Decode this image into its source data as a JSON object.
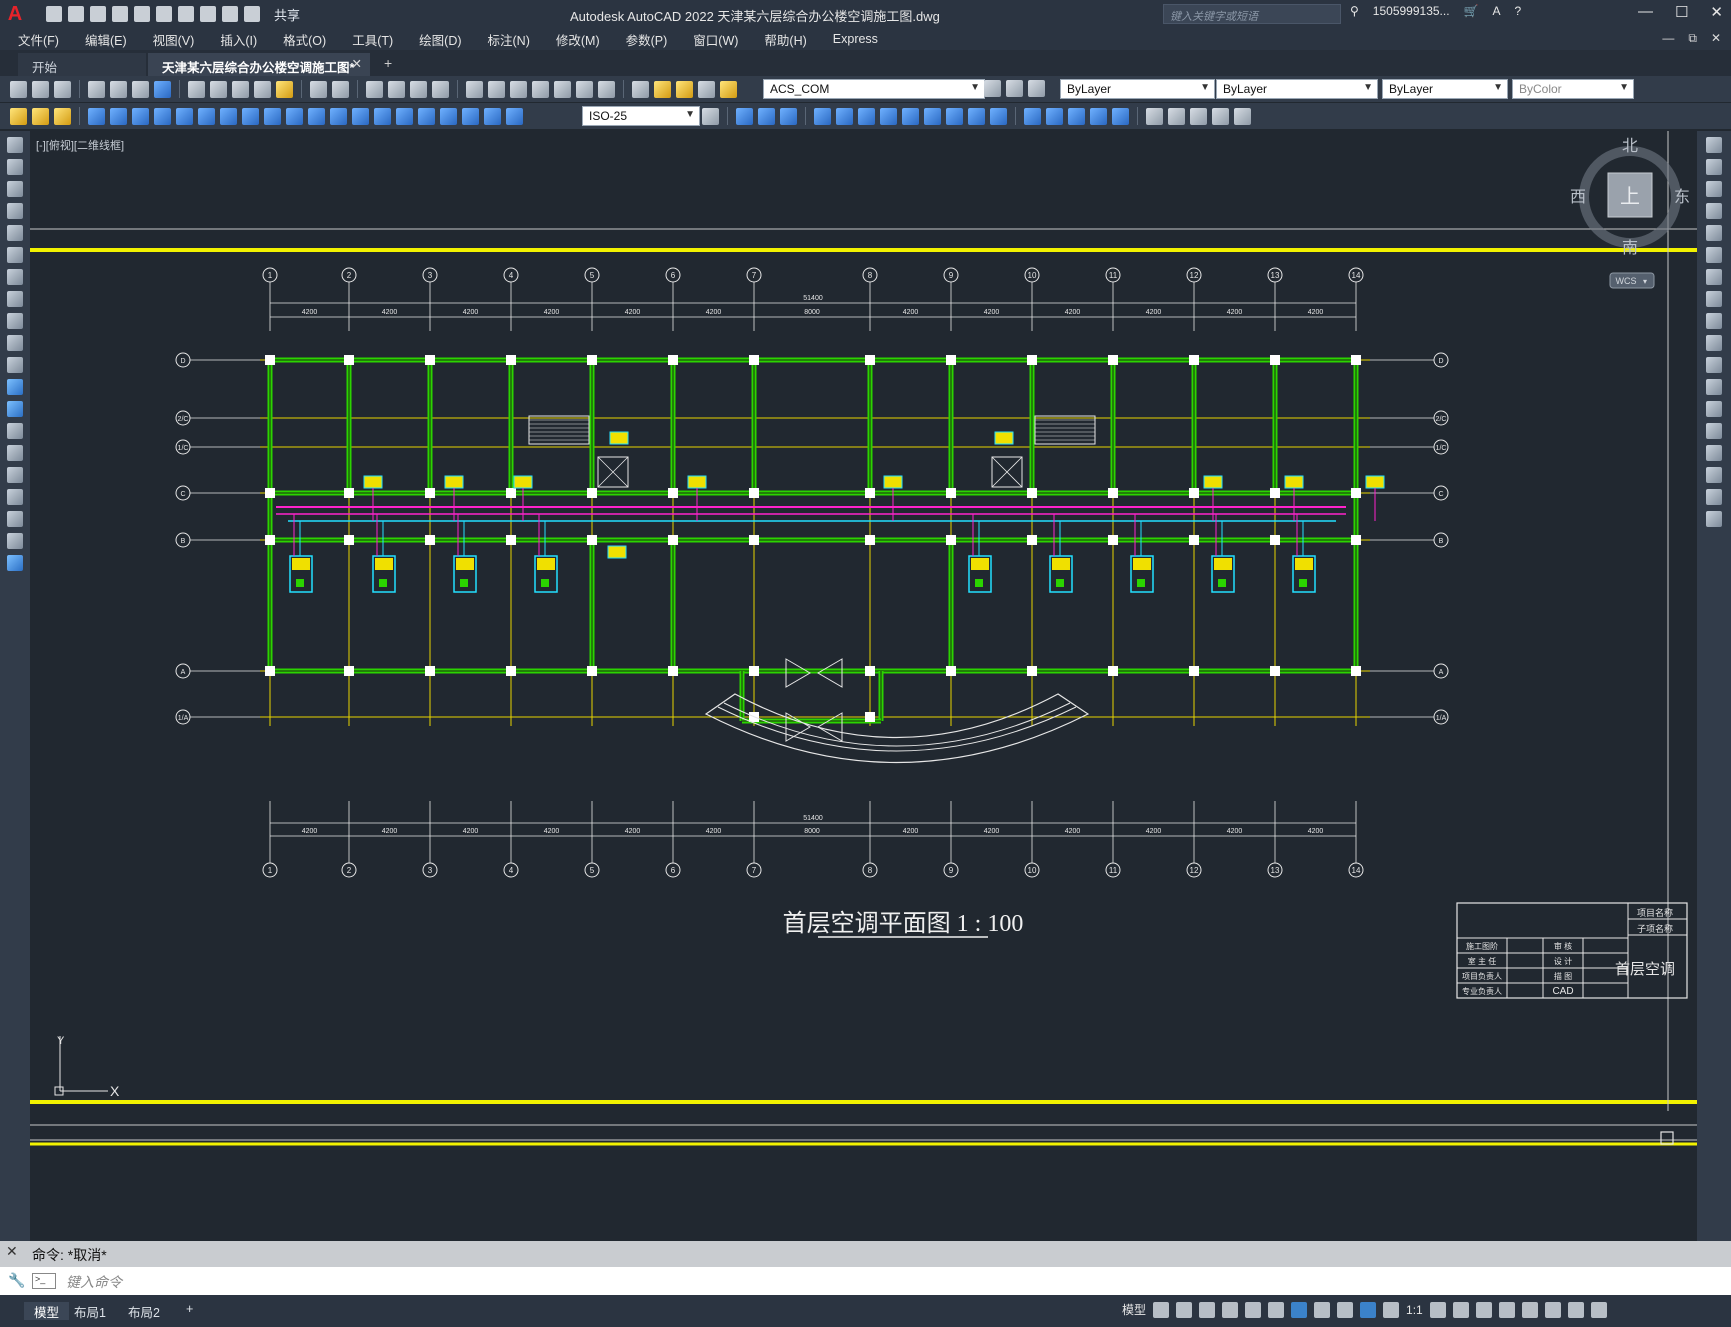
{
  "titlebar": {
    "logo": "A",
    "share": "共享",
    "app_title": "Autodesk AutoCAD 2022    天津某六层综合办公楼空调施工图.dwg",
    "search_placeholder": "键入关键字或短语",
    "user": "1505999135...",
    "help": "?"
  },
  "menu": [
    "文件(F)",
    "编辑(E)",
    "视图(V)",
    "插入(I)",
    "格式(O)",
    "工具(T)",
    "绘图(D)",
    "标注(N)",
    "修改(M)",
    "参数(P)",
    "窗口(W)",
    "帮助(H)",
    "Express"
  ],
  "tabs": {
    "start": "开始",
    "active": "天津某六层综合办公楼空调施工图*"
  },
  "toolbar": {
    "layer": "ACS_COM",
    "color": "ByLayer",
    "linetype": "ByLayer",
    "lineweight": "ByLayer",
    "plotstyle": "ByColor",
    "dimstyle": "ISO-25"
  },
  "view_label": "[-][俯视][二维线框]",
  "viewcube": {
    "north": "北",
    "south": "南",
    "east": "东",
    "west": "西",
    "face": "上",
    "wcs": "WCS"
  },
  "drawing": {
    "title": "首层空调平面图 1 : 100",
    "overall_dim": "51400",
    "dims": [
      "4200",
      "4200",
      "4200",
      "4200",
      "4200",
      "4200",
      "8000",
      "4200",
      "4200",
      "4200",
      "4200",
      "4200",
      "4200"
    ],
    "grid_numbers": [
      "1",
      "2",
      "3",
      "4",
      "5",
      "6",
      "7",
      "8",
      "9",
      "10",
      "11",
      "12",
      "13",
      "14"
    ],
    "grid_letters": [
      "D",
      "2/C",
      "1/C",
      "C",
      "B",
      "A",
      "1/A"
    ],
    "title_block": {
      "rows": [
        [
          "施工图阶",
          "审 核"
        ],
        [
          "室 主 任",
          "设 计"
        ],
        [
          "项目负责人",
          "描 图"
        ],
        [
          "专业负责人",
          "CAD"
        ]
      ],
      "project_name": "项目名称",
      "sub_name": "子项名称",
      "drawing_name": "首层空调"
    }
  },
  "command": {
    "history": "命令:  *取消*",
    "placeholder": "键入命令"
  },
  "status": {
    "tabs": [
      "模型",
      "布局1",
      "布局2"
    ],
    "model": "模型",
    "scale": "1:1"
  }
}
